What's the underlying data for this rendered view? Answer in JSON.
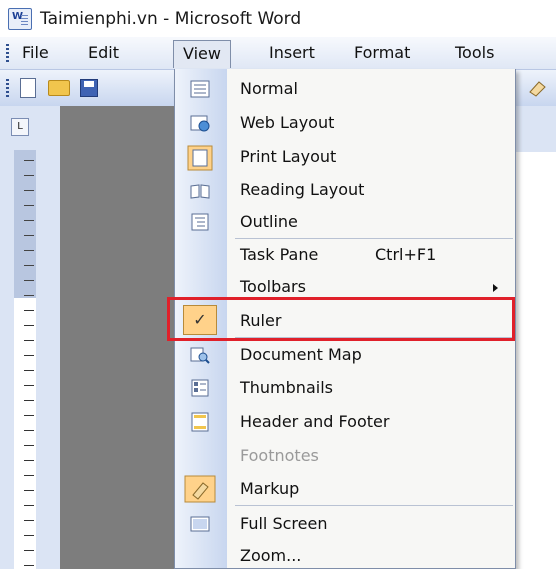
{
  "window": {
    "title": "Taimienphi.vn - Microsoft Word"
  },
  "menubar": {
    "items": [
      "File",
      "Edit",
      "View",
      "Insert",
      "Format",
      "Tools"
    ]
  },
  "view_menu": {
    "items": [
      {
        "label": "Normal",
        "icon": "normal-view-icon"
      },
      {
        "label": "Web Layout",
        "icon": "web-layout-icon"
      },
      {
        "label": "Print Layout",
        "icon": "print-layout-icon",
        "selected": true
      },
      {
        "label": "Reading Layout",
        "icon": "reading-layout-icon"
      },
      {
        "label": "Outline",
        "icon": "outline-icon"
      },
      {
        "label": "Task Pane",
        "shortcut": "Ctrl+F1"
      },
      {
        "label": "Toolbars",
        "submenu": true
      },
      {
        "label": "Ruler",
        "icon": "check-icon",
        "checked": true,
        "highlighted": true
      },
      {
        "label": "Document Map",
        "icon": "document-map-icon"
      },
      {
        "label": "Thumbnails",
        "icon": "thumbnails-icon"
      },
      {
        "label": "Header and Footer",
        "icon": "header-footer-icon"
      },
      {
        "label": "Footnotes",
        "disabled": true
      },
      {
        "label": "Markup",
        "icon": "markup-icon",
        "checked": true
      },
      {
        "label": "Full Screen",
        "icon": "full-screen-icon"
      },
      {
        "label": "Zoom..."
      }
    ]
  },
  "colors": {
    "highlight_border": "#e0202a",
    "menu_background": "#f7f7f5",
    "icon_strip": "#c8d6ef"
  }
}
